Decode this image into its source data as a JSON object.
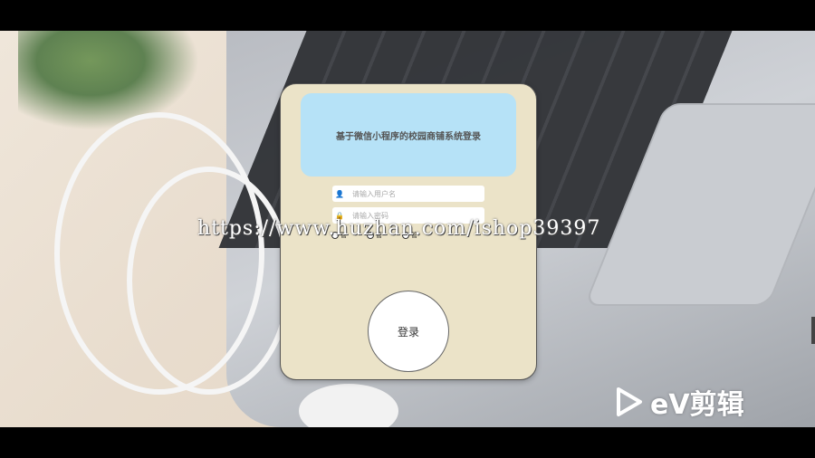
{
  "login": {
    "title": "基于微信小程序的校园商铺系统登录",
    "username_placeholder": "请输入用户名",
    "password_placeholder": "请输入密码",
    "roles": [
      "管",
      "管",
      "管"
    ],
    "submit_label": "登录"
  },
  "overlay": {
    "watermark": "https://www.huzhan.com/ishop39397",
    "brand": "eV剪辑"
  },
  "colors": {
    "card_bg": "#ebe3c8",
    "header_bg": "#b6e2f7"
  }
}
